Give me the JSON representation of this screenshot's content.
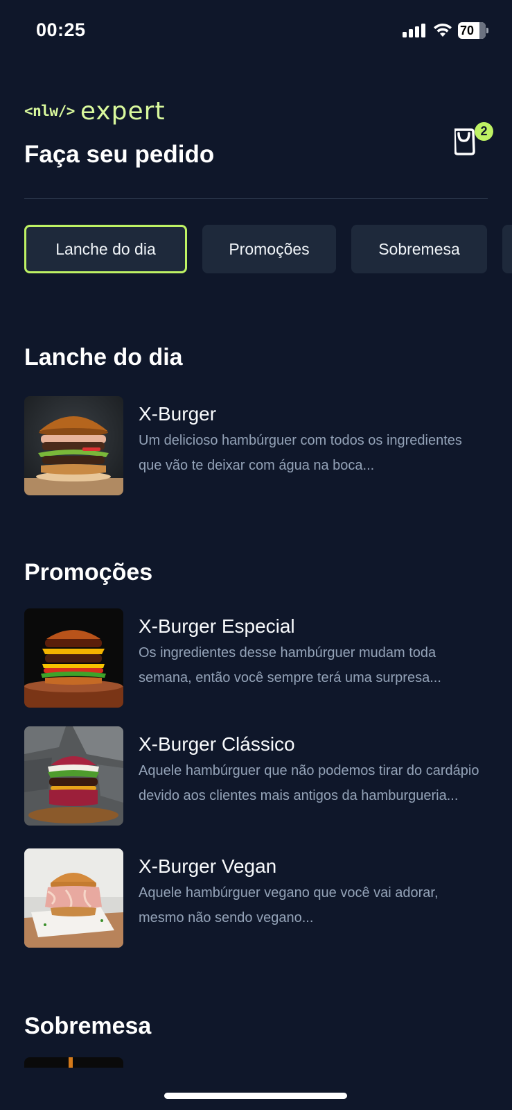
{
  "status_bar": {
    "time": "00:25",
    "battery": "70"
  },
  "header": {
    "logo_code": "<nlw/>",
    "logo_word": "expert",
    "title": "Faça seu pedido",
    "cart_count": "2"
  },
  "tabs": [
    {
      "label": "Lanche do dia",
      "active": true
    },
    {
      "label": "Promoções",
      "active": false
    },
    {
      "label": "Sobremesa",
      "active": false
    },
    {
      "label": "",
      "active": false
    }
  ],
  "sections": [
    {
      "title": "Lanche do dia",
      "items": [
        {
          "name": "X-Burger",
          "description": "Um delicioso hambúrguer com todos os ingredientes que vão te deixar com água na boca..."
        }
      ]
    },
    {
      "title": "Promoções",
      "items": [
        {
          "name": "X-Burger Especial",
          "description": "Os ingredientes desse hambúrguer mudam toda semana, então você sempre terá uma surpresa..."
        },
        {
          "name": "X-Burger Clássico",
          "description": "Aquele hambúrguer que não podemos tirar do cardápio devido aos clientes mais antigos da hamburgueria..."
        },
        {
          "name": "X-Burger Vegan",
          "description": "Aquele hambúrguer vegano que você vai adorar, mesmo não sendo vegano..."
        }
      ]
    },
    {
      "title": "Sobremesa",
      "items": []
    }
  ],
  "colors": {
    "background": "#0f172a",
    "accent": "#bef264",
    "card": "#1e293b",
    "muted_text": "#94a3b8"
  }
}
